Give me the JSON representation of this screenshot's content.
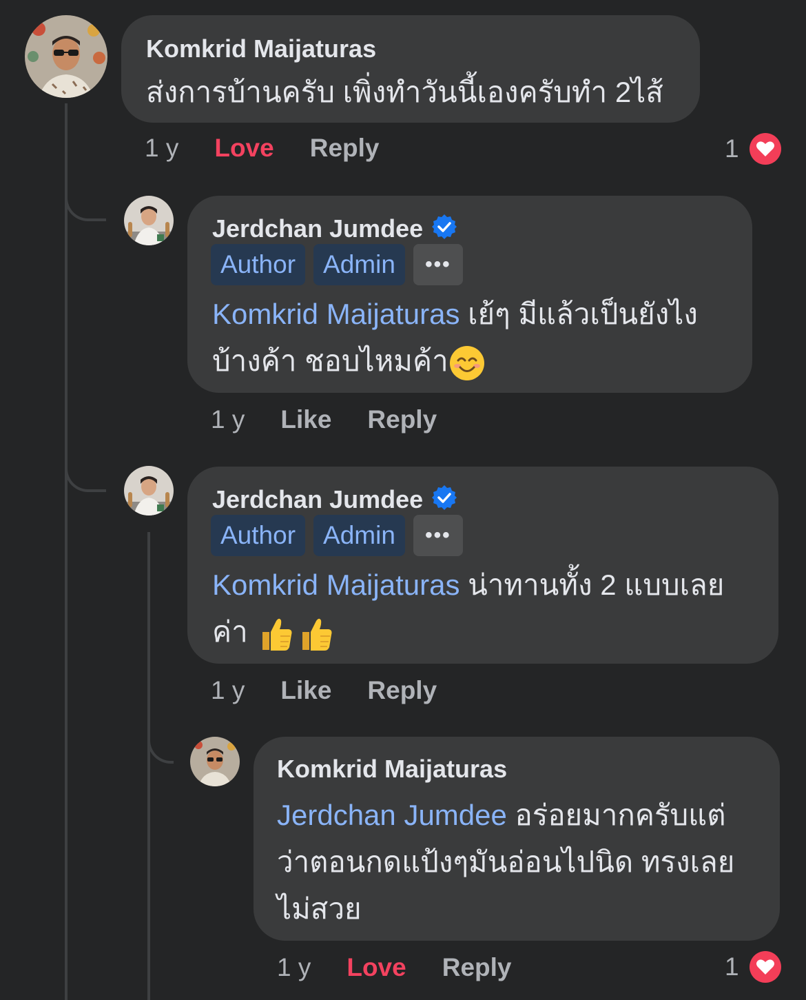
{
  "comments": [
    {
      "author": "Komkrid Maijaturas",
      "text": "ส่งการบ้านครับ เพิ่งทำวันนี้เองครับทำ 2ไส้",
      "time": "1 y",
      "like_label": "Love",
      "reply_label": "Reply",
      "reaction_count": "1"
    },
    {
      "author": "Jerdchan Jumdee",
      "badges": [
        "Author",
        "Admin"
      ],
      "more_label": "•••",
      "mention": "Komkrid Maijaturas",
      "text_line1": " เย้ๆ มีแล้วเป็นยังไง",
      "text_line2": "บ้างค้า ชอบไหมค้า",
      "time": "1 y",
      "like_label": "Like",
      "reply_label": "Reply"
    },
    {
      "author": "Jerdchan Jumdee",
      "badges": [
        "Author",
        "Admin"
      ],
      "more_label": "•••",
      "mention": "Komkrid Maijaturas",
      "text_line1": " น่าทานทั้ง 2 แบบเลย",
      "text_line2": "ค่า ",
      "time": "1 y",
      "like_label": "Like",
      "reply_label": "Reply"
    },
    {
      "author": "Komkrid Maijaturas",
      "mention": "Jerdchan Jumdee",
      "text_line1": " อร่อยมากครับแต่",
      "text_line2": "ว่าตอนกดแป้งๆมันอ่อนไปนิด ทรงเลย",
      "text_line3": "ไม่สวย",
      "time": "1 y",
      "like_label": "Love",
      "reply_label": "Reply",
      "reaction_count": "1"
    }
  ],
  "icons": {
    "verified": "verified-badge-icon",
    "heart": "heart-reaction-icon",
    "smile": "smiling-face-emoji",
    "thumbs": "thumbs-up-emoji"
  },
  "colors": {
    "background": "#242526",
    "bubble": "#3a3b3c",
    "mention": "#8ab4f8",
    "love": "#f3425f",
    "verified": "#1877f2"
  }
}
